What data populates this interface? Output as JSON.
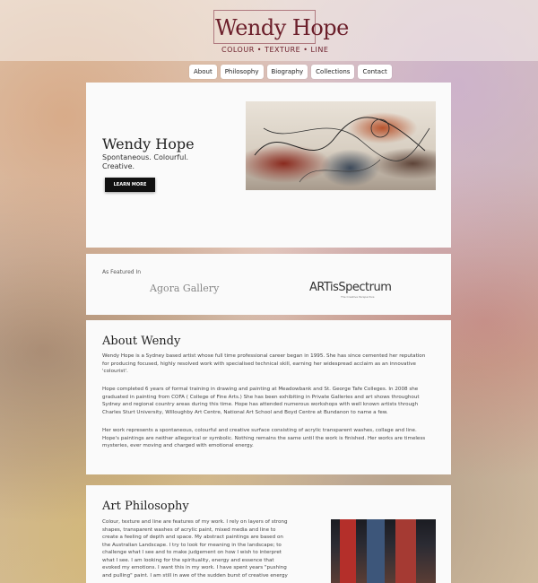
{
  "header": {
    "logo_title": "Wendy Hope",
    "logo_subtitle": "COLOUR • TEXTURE • LINE"
  },
  "nav": {
    "items": [
      {
        "label": "About"
      },
      {
        "label": "Philosophy"
      },
      {
        "label": "Biography"
      },
      {
        "label": "Collections"
      },
      {
        "label": "Contact"
      }
    ]
  },
  "hero": {
    "title": "Wendy Hope",
    "tagline": "Spontaneous. Colourful. Creative.",
    "button": "LEARN MORE"
  },
  "featured": {
    "label": "As Featured In",
    "logo1": "Agora Gallery",
    "logo2": "ARTisSpectrum",
    "logo2_sub": "The Creative Perspective"
  },
  "about": {
    "title": "About Wendy",
    "p1": "Wendy Hope is a Sydney based artist whose full time professional career began in 1995. She has since cemented her reputation for producing focused, highly resolved work with specialised technical skill, earning her widespread acclaim as an innovative 'colourist'.",
    "p2": "Hope completed 6 years of formal training in drawing and painting at Meadowbank and St. George Tafe Colleges. In 2008 she graduated in painting from COFA ( College of Fine Arts.) She has been exhibiting in Private Galleries and art shows throughout Sydney and regional country areas during this time. Hope has attended numerous workshops with well known artists through Charles Sturt University, Willoughby Art Centre, National Art School and Boyd Centre at Bundanon to name a few.",
    "p3": "Her work represents a spontaneous, colourful and creative surface consisting of acrylic transparent washes, collage and line. Hope's paintings are neither allegorical or symbolic. Nothing remains the same until the work is finished. Her works are timeless mysteries, ever moving and charged with emotional energy."
  },
  "philosophy": {
    "title": "Art Philosophy",
    "p1": "Colour, texture and line are features of my work. I rely on layers of strong shapes, transparent washes of acrylic paint, mixed media and line to create a feeling of depth and space. My abstract paintings are based on the Australian Landscape. I try to look for meaning in the landscape; to challenge what I see and to make judgement on how I wish to interpret what I see. I am looking for the spirituality, energy and essence that evoked my emotions. I want this in my work. I have spent years \"pushing and pulling\" paint. I am still in awe of the sudden burst of creative energy"
  }
}
